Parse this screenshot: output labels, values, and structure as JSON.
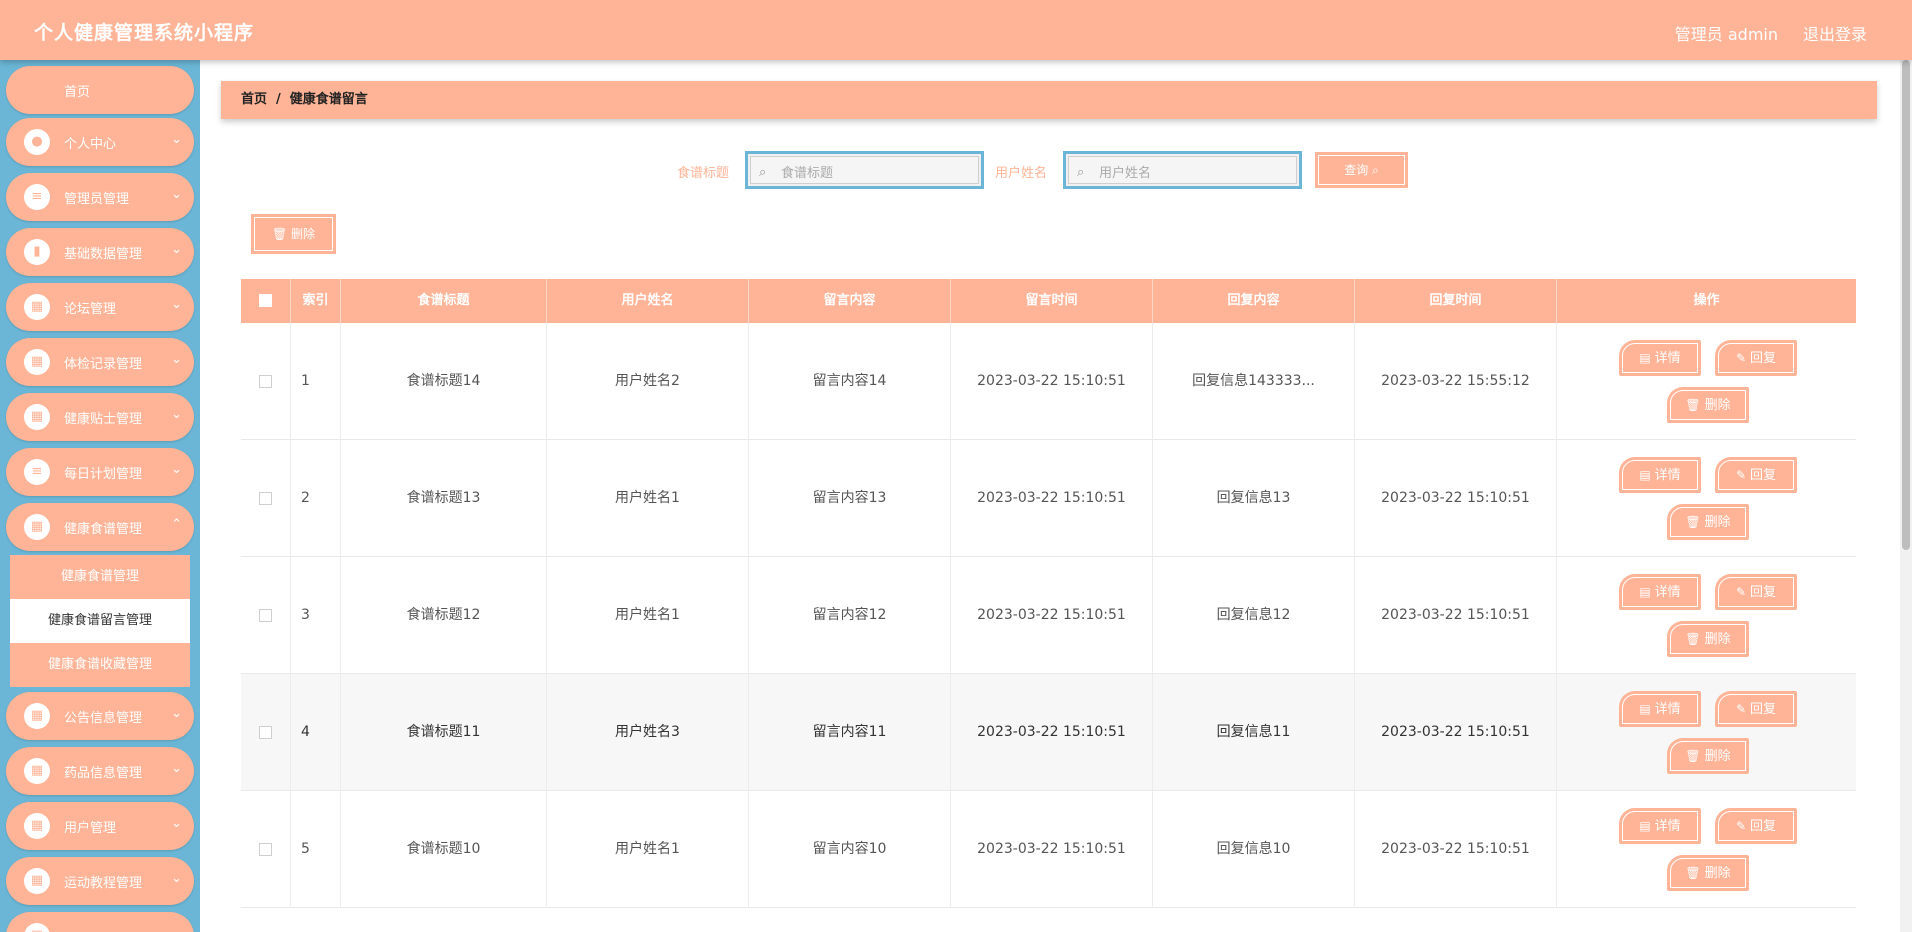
{
  "app": {
    "title": "个人健康管理系统小程序",
    "user": "管理员 admin",
    "logout": "退出登录"
  },
  "sidebar": {
    "home": "首页",
    "items": [
      {
        "label": "个人中心",
        "icon": "user-icon"
      },
      {
        "label": "管理员管理",
        "icon": "list-icon"
      },
      {
        "label": "基础数据管理",
        "icon": "book-icon"
      },
      {
        "label": "论坛管理",
        "icon": "grid-icon"
      },
      {
        "label": "体检记录管理",
        "icon": "grid-icon"
      },
      {
        "label": "健康贴士管理",
        "icon": "grid-icon"
      },
      {
        "label": "每日计划管理",
        "icon": "list-icon"
      },
      {
        "label": "健康食谱管理",
        "icon": "grid-icon"
      }
    ],
    "submenu": [
      {
        "label": "健康食谱管理"
      },
      {
        "label": "健康食谱留言管理"
      },
      {
        "label": "健康食谱收藏管理"
      }
    ],
    "items_after": [
      {
        "label": "公告信息管理",
        "icon": "grid-icon"
      },
      {
        "label": "药品信息管理",
        "icon": "grid-icon"
      },
      {
        "label": "用户管理",
        "icon": "grid-icon"
      },
      {
        "label": "运动教程管理",
        "icon": "grid-icon"
      }
    ]
  },
  "breadcrumb": {
    "home": "首页",
    "separator": "/",
    "current": "健康食谱留言"
  },
  "search": {
    "title_label": "食谱标题",
    "title_placeholder": "食谱标题",
    "user_label": "用户姓名",
    "user_placeholder": "用户姓名",
    "query_button": "查询"
  },
  "toolbar": {
    "delete_label": "删除"
  },
  "table": {
    "columns": [
      "索引",
      "食谱标题",
      "用户姓名",
      "留言内容",
      "留言时间",
      "回复内容",
      "回复时间",
      "操作"
    ],
    "actions": {
      "detail": "详情",
      "reply": "回复",
      "delete": "删除"
    },
    "rows": [
      {
        "index": "1",
        "recipe_title": "食谱标题14",
        "user_name": "用户姓名2",
        "message": "留言内容14",
        "message_time": "2023-03-22 15:10:51",
        "reply": "回复信息143333...",
        "reply_time": "2023-03-22 15:55:12"
      },
      {
        "index": "2",
        "recipe_title": "食谱标题13",
        "user_name": "用户姓名1",
        "message": "留言内容13",
        "message_time": "2023-03-22 15:10:51",
        "reply": "回复信息13",
        "reply_time": "2023-03-22 15:10:51"
      },
      {
        "index": "3",
        "recipe_title": "食谱标题12",
        "user_name": "用户姓名1",
        "message": "留言内容12",
        "message_time": "2023-03-22 15:10:51",
        "reply": "回复信息12",
        "reply_time": "2023-03-22 15:10:51"
      },
      {
        "index": "4",
        "recipe_title": "食谱标题11",
        "user_name": "用户姓名3",
        "message": "留言内容11",
        "message_time": "2023-03-22 15:10:51",
        "reply": "回复信息11",
        "reply_time": "2023-03-22 15:10:51"
      },
      {
        "index": "5",
        "recipe_title": "食谱标题10",
        "user_name": "用户姓名1",
        "message": "留言内容10",
        "message_time": "2023-03-22 15:10:51",
        "reply": "回复信息10",
        "reply_time": "2023-03-22 15:10:51"
      }
    ]
  },
  "colors": {
    "accent": "#ffb497",
    "sidebar_bg": "#6bb6d6",
    "white": "#ffffff"
  }
}
